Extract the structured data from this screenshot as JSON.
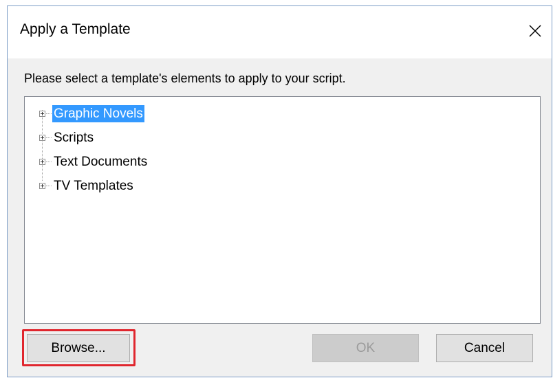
{
  "dialog": {
    "title": "Apply a Template",
    "close_icon": "close-icon"
  },
  "instruction": "Please select a template's elements to apply to your script.",
  "tree": {
    "items": [
      {
        "label": "Graphic Novels",
        "selected": true,
        "expander_icon": "plus-expander-icon"
      },
      {
        "label": "Scripts",
        "selected": false,
        "expander_icon": "plus-expander-icon"
      },
      {
        "label": "Text Documents",
        "selected": false,
        "expander_icon": "plus-expander-icon"
      },
      {
        "label": "TV Templates",
        "selected": false,
        "expander_icon": "plus-expander-icon"
      }
    ]
  },
  "buttons": {
    "browse": "Browse...",
    "ok": "OK",
    "ok_enabled": false,
    "cancel": "Cancel"
  },
  "colors": {
    "selection": "#3399ff",
    "highlight_box": "#e0262e",
    "dialog_background": "#f0f0f0"
  }
}
